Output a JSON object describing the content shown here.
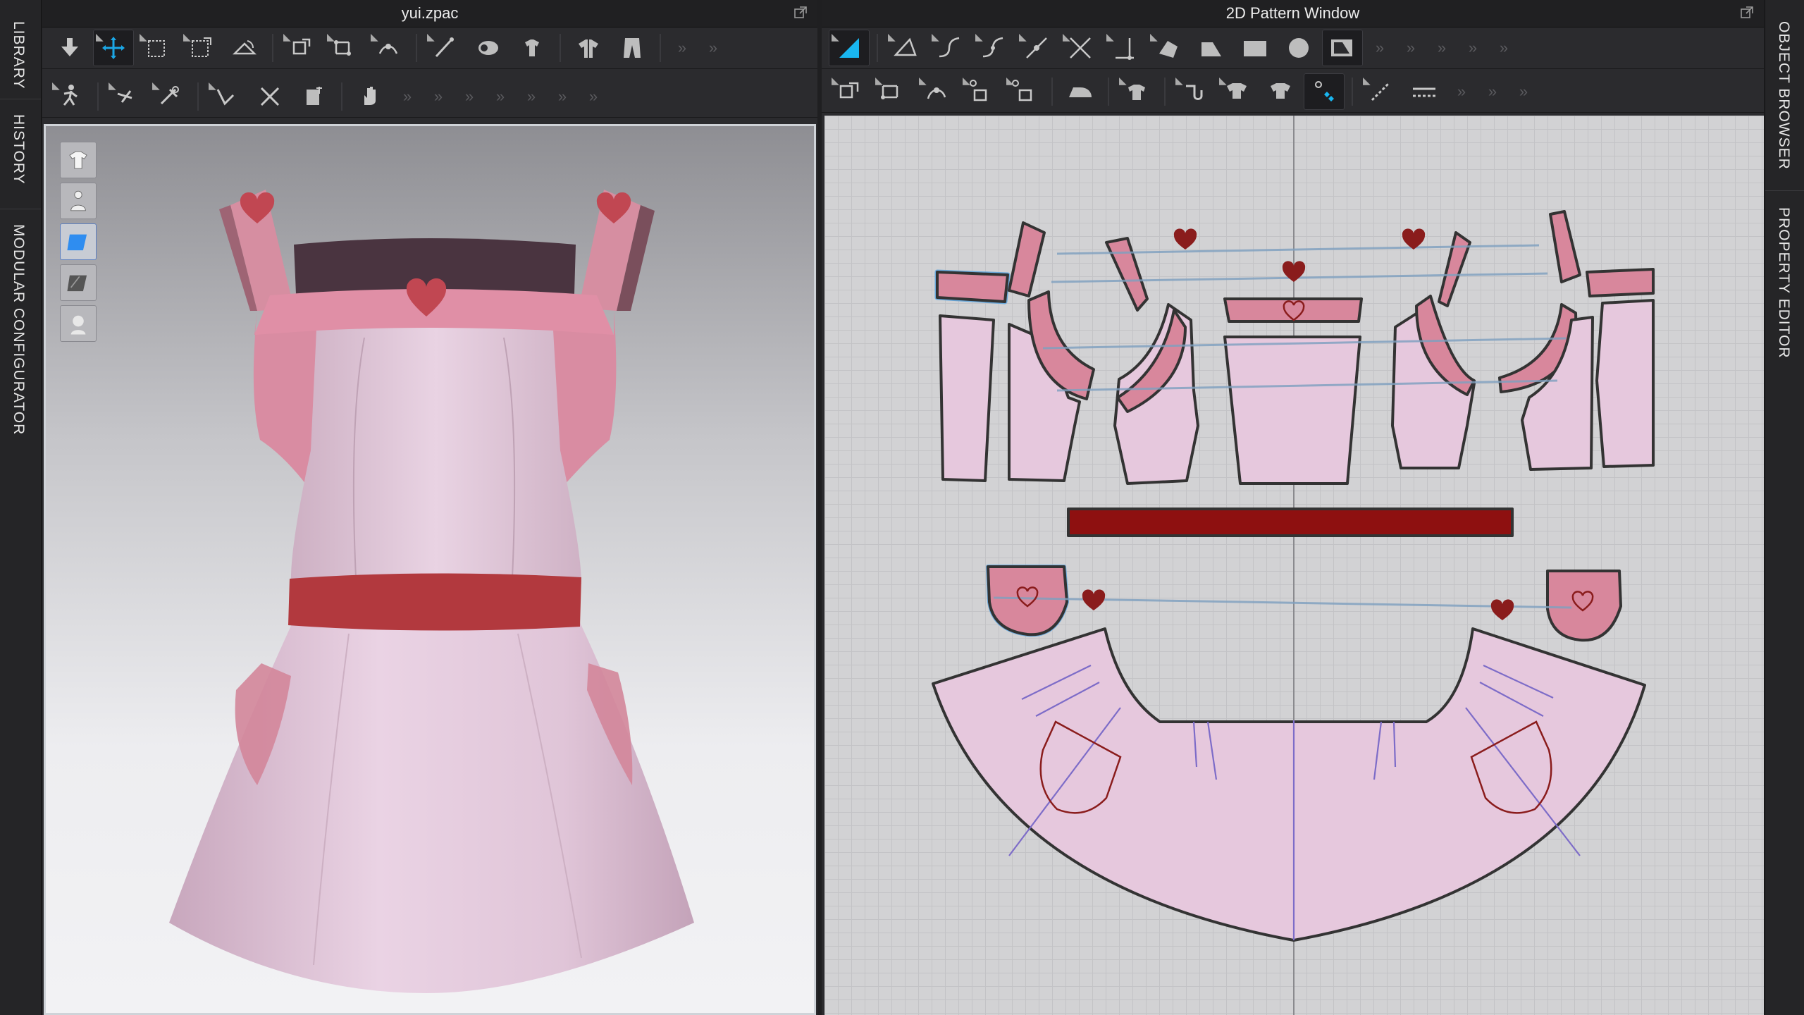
{
  "left_rail": {
    "tabs": [
      "LIBRARY",
      "HISTORY",
      "MODULAR CONFIGURATOR"
    ]
  },
  "right_rail": {
    "tabs": [
      "OBJECT BROWSER",
      "PROPERTY EDITOR"
    ]
  },
  "panel3d": {
    "title": "yui.zpac",
    "toolbar_row1": [
      "import-icon",
      "transform-pattern-icon",
      "select-box-icon",
      "transform-icon",
      "fold-icon",
      "tack-icon",
      "tack-multi-icon",
      "tack-layer-icon",
      "pen-icon",
      "fabric-roll-icon",
      "garment-add-icon",
      "shirt-icon",
      "pants-icon"
    ],
    "toolbar_row2": [
      "avatar-pose-icon",
      "edit-pin-icon",
      "sewing-needle-icon",
      "measure-icon",
      "cut-icon",
      "garment-fit-icon",
      "hand-icon"
    ],
    "viewport_icons": [
      "show-garment-icon",
      "show-avatar-icon",
      "texture-view-icon",
      "mesh-view-icon",
      "avatar-head-icon"
    ]
  },
  "panel2d": {
    "title": "2D Pattern Window",
    "toolbar_row1": [
      "edit-pattern-icon",
      "transform-pattern-icon",
      "edit-curve-icon",
      "curve-point-icon",
      "add-point-icon",
      "cut-pattern-icon",
      "dart-icon",
      "slash-spread-icon",
      "polygon-icon",
      "rectangle-icon",
      "circle-icon",
      "internal-polygon-icon"
    ],
    "toolbar_row2": [
      "segment-sewing-icon",
      "free-sewing-icon",
      "m-n-sewing-icon",
      "check-sewing-icon",
      "edit-sewing-icon",
      "iron-icon",
      "garment-fit-icon",
      "pin-icon",
      "fold-arrange-icon",
      "trim-icon",
      "pattern-grain-icon",
      "seam-tape-icon",
      "line-style-icon"
    ]
  },
  "colors": {
    "pattern_fill": "#e6c8dd",
    "pattern_pink": "#d8879c",
    "belt_red": "#8e1010",
    "outline": "#333333",
    "heart": "#8a1c1c"
  }
}
